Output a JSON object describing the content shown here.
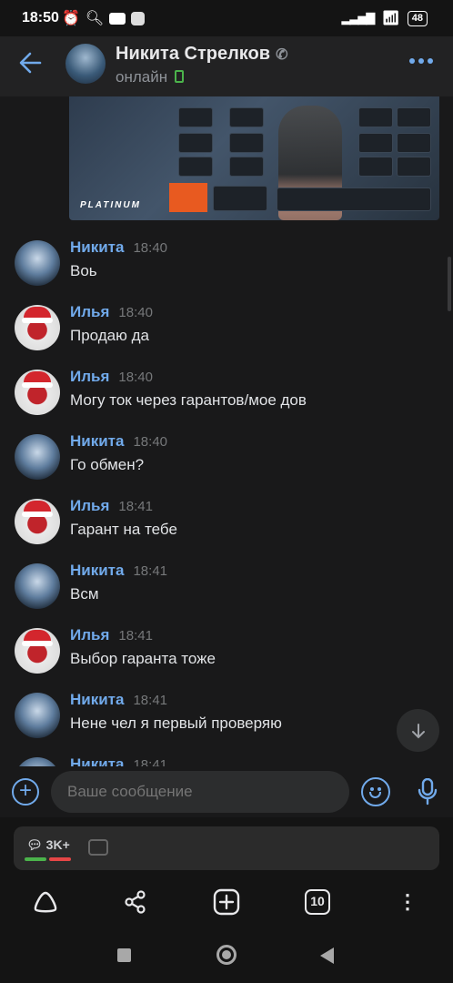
{
  "status_bar": {
    "time": "18:50",
    "battery": "48"
  },
  "header": {
    "name": "Никита Стрелков",
    "status": "онлайн"
  },
  "image": {
    "brand": "PLATINUM"
  },
  "messages": [
    {
      "sender": "Никита",
      "time": "18:40",
      "text": "Воь",
      "avatar": "nikita"
    },
    {
      "sender": "Илья",
      "time": "18:40",
      "text": "Продаю да",
      "avatar": "ilya"
    },
    {
      "sender": "Илья",
      "time": "18:40",
      "text": "Могу ток через гарантов/мое дов",
      "avatar": "ilya"
    },
    {
      "sender": "Никита",
      "time": "18:40",
      "text": "Го обмен?",
      "avatar": "nikita"
    },
    {
      "sender": "Илья",
      "time": "18:41",
      "text": "Гарант на тебе",
      "avatar": "ilya"
    },
    {
      "sender": "Никита",
      "time": "18:41",
      "text": "Всм",
      "avatar": "nikita"
    },
    {
      "sender": "Илья",
      "time": "18:41",
      "text": "Выбор гаранта тоже",
      "avatar": "ilya"
    },
    {
      "sender": "Никита",
      "time": "18:41",
      "text": "Нене чел я первый проверяю",
      "avatar": "nikita"
    },
    {
      "sender": "Никита",
      "time": "18:41",
      "text": "",
      "avatar": "nikita"
    }
  ],
  "composer": {
    "placeholder": "Ваше сообщение"
  },
  "browser": {
    "counter": "3K+",
    "tabs_count": "10"
  },
  "colors": {
    "accent": "#71aaeb",
    "online": "#4bb34b",
    "bg": "#19191a"
  },
  "icons": [
    "back-arrow-icon",
    "phone-icon",
    "more-icon",
    "add-icon",
    "smile-icon",
    "mic-icon",
    "scroll-down-icon",
    "home-icon",
    "share-icon",
    "new-tab-icon",
    "tabs-icon",
    "menu-icon"
  ]
}
